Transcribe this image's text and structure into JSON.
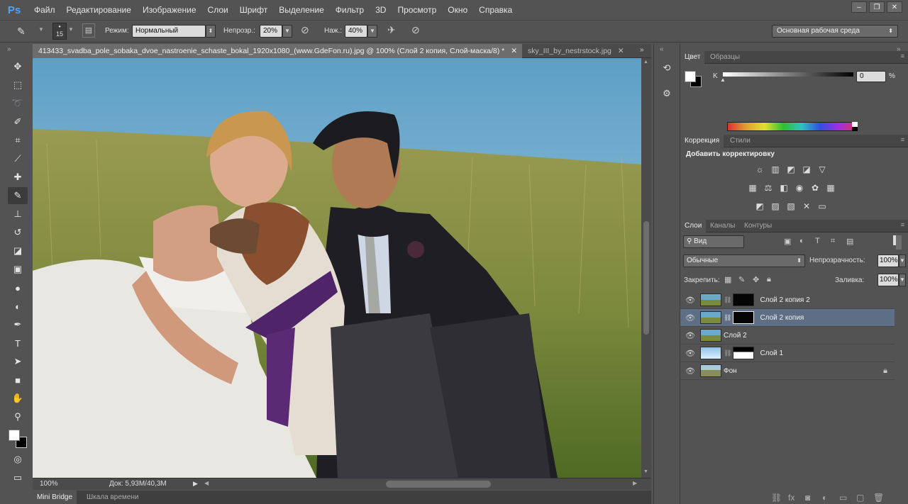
{
  "app": {
    "logo": "Ps"
  },
  "menu": [
    "Файл",
    "Редактирование",
    "Изображение",
    "Слои",
    "Шрифт",
    "Выделение",
    "Фильтр",
    "3D",
    "Просмотр",
    "Окно",
    "Справка"
  ],
  "window_controls": {
    "minimize": "–",
    "restore": "❐",
    "close": "✕"
  },
  "options": {
    "brush_size": "15",
    "mode_label": "Режим:",
    "mode_value": "Нормальный",
    "opacity_label": "Непрозр.:",
    "opacity_value": "20%",
    "flow_label": "Наж.:",
    "flow_value": "40%",
    "workspace": "Основная рабочая среда"
  },
  "tabs": [
    "413433_svadba_pole_sobaka_dvoe_nastroenie_schaste_bokal_1920x1080_(www.GdeFon.ru).jpg @ 100% (Слой 2 копия, Слой-маска/8) *",
    "sky_III_by_nestrstock.jpg"
  ],
  "tab_close": "✕",
  "status": {
    "zoom": "100%",
    "doc": "Док: 5,93M/40,3M"
  },
  "bottom_tabs": [
    "Mini Bridge",
    "Шкала времени"
  ],
  "color_panel": {
    "tabs": [
      "Цвет",
      "Образцы"
    ],
    "channel_label": "K",
    "value": "0",
    "unit": "%",
    "slider_value": 0
  },
  "adjust_panel": {
    "tabs": [
      "Коррекция",
      "Стили"
    ],
    "title": "Добавить корректировку",
    "icons": [
      "brightness-icon",
      "levels-icon",
      "curves-icon",
      "exposure-icon",
      "vibrance-icon",
      "hue-saturation-icon",
      "color-balance-icon",
      "black-white-icon",
      "photo-filter-icon",
      "channel-mixer-icon",
      "color-lookup-icon",
      "invert-icon",
      "posterize-icon",
      "threshold-icon",
      "selective-color-icon",
      "gradient-map-icon"
    ]
  },
  "layers_panel": {
    "tabs": [
      "Слои",
      "Каналы",
      "Контуры"
    ],
    "filter_kind": "Вид",
    "blend_mode": "Обычные",
    "opacity_label": "Непрозрачность:",
    "opacity_value": "100%",
    "lock_label": "Закрепить:",
    "fill_label": "Заливка:",
    "fill_value": "100%",
    "layers": [
      {
        "name": "Слой 2 копия 2",
        "selected": false,
        "mask": true
      },
      {
        "name": "Слой 2 копия",
        "selected": true,
        "mask": true
      },
      {
        "name": "Слой 2",
        "selected": false,
        "mask": false
      },
      {
        "name": "Слой 1",
        "selected": false,
        "mask": true
      },
      {
        "name": "Фон",
        "selected": false,
        "mask": false,
        "locked": true
      }
    ]
  },
  "colors": {
    "accent": "#4da3ff",
    "selection": "#5e6f85",
    "panel": "#535353"
  }
}
